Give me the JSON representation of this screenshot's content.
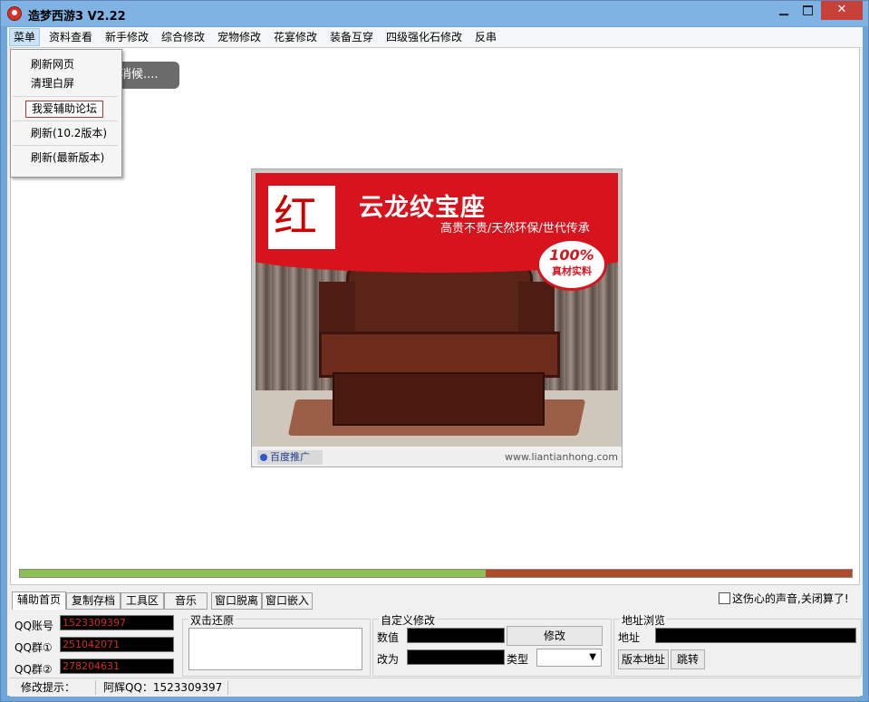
{
  "window": {
    "title": "造梦西游3 V2.22"
  },
  "menu": [
    "菜单",
    "资料查看",
    "新手修改",
    "综合修改",
    "宠物修改",
    "花宴修改",
    "装备互穿",
    "四级强化石修改",
    "反串"
  ],
  "dropdown": {
    "items": [
      "刷新网页",
      "清理白屏",
      "我爱辅助论坛",
      "刷新(10.2版本)",
      "刷新(最新版本)"
    ]
  },
  "browser": {
    "tooltip": "消候....",
    "ad": {
      "logo_text": "红",
      "title": "云龙纹宝座",
      "subtitle": "高贵不贵/天然环保/世代传承",
      "badge_top": "100%",
      "badge_bottom": "真材实料",
      "baidu_label": "百度推广",
      "url": "www.liantianhong.com"
    }
  },
  "progress": {
    "value": 0.56,
    "fill_color": "#8dbf55",
    "track_color": "#b04a2a"
  },
  "tabs": [
    "辅助首页",
    "复制存档",
    "工具区",
    "音乐",
    "窗口脱离",
    "窗口嵌入"
  ],
  "sound_option": "这伤心的声音,关闭算了!",
  "home": {
    "qq_account_label": "QQ账号",
    "qq_account_value": "1523309397",
    "qq_group1_label": "QQ群①",
    "qq_group1_value": "251042071",
    "qq_group2_label": "QQ群②",
    "qq_group2_value": "278204631",
    "restore_label": "双击还原",
    "custom_label": "自定义修改",
    "value_label": "数值",
    "change_to_label": "改为",
    "type_label": "类型",
    "modify_button": "修改",
    "address_browse_label": "地址浏览",
    "address_label": "地址",
    "version_address_button": "版本地址",
    "jump_button": "跳转"
  },
  "status": {
    "hint_label": "修改提示：",
    "author": "阿辉QQ：1523309397"
  }
}
